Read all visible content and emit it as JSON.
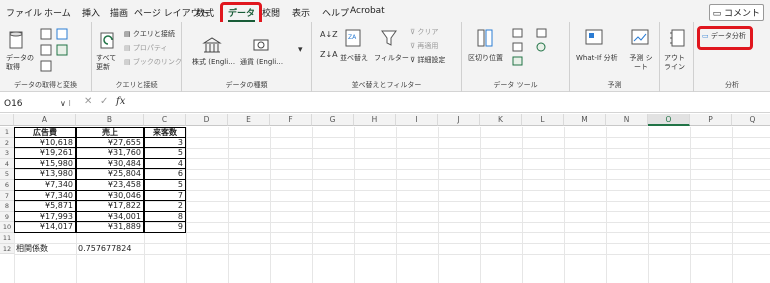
{
  "menu": {
    "tabs": [
      "ファイル",
      "ホーム",
      "挿入",
      "描画",
      "ページ レイアウト",
      "数式",
      "データ",
      "校閲",
      "表示",
      "ヘルプ",
      "Acrobat"
    ],
    "active": "データ",
    "comment_label": "コメント"
  },
  "ribbon": {
    "get_data": {
      "label": "データの 取得",
      "title": "データの取得と変換"
    },
    "refresh": {
      "label": "すべて 更新",
      "query_conn": "クエリと接続",
      "properties": "プロパティ",
      "links": "ブックのリンク",
      "title": "クエリと接続"
    },
    "datatypes": {
      "stock": "株式 (Engli…",
      "currency": "通貨 (Engli…",
      "title": "データの種類"
    },
    "sort": {
      "sort_btn": "並べ替え",
      "filter": "フィルター",
      "clear": "クリア",
      "reapply": "再適用",
      "advanced": "詳細設定",
      "title": "並べ替えとフィルター"
    },
    "tools": {
      "split": "区切り位置",
      "title": "データ ツール"
    },
    "forecast": {
      "whatif": "What-If 分析",
      "sheet": "予測 シート",
      "title": "予測"
    },
    "outline": {
      "label": "アウト ライン"
    },
    "analysis": {
      "button": "データ分析",
      "title": "分析"
    }
  },
  "formula_bar": {
    "cell_ref": "O16",
    "fx": "fx",
    "value": ""
  },
  "columns": [
    "A",
    "B",
    "C",
    "D",
    "E",
    "F",
    "G",
    "H",
    "I",
    "J",
    "K",
    "L",
    "M",
    "N",
    "O",
    "P",
    "Q"
  ],
  "selected_column": "O",
  "headers": [
    "広告費",
    "売上",
    "来客数"
  ],
  "rows": [
    [
      "¥10,618",
      "¥27,655",
      "3"
    ],
    [
      "¥19,261",
      "¥31,760",
      "5"
    ],
    [
      "¥15,980",
      "¥30,484",
      "4"
    ],
    [
      "¥13,980",
      "¥25,804",
      "6"
    ],
    [
      "¥7,340",
      "¥23,458",
      "5"
    ],
    [
      "¥7,340",
      "¥30,046",
      "7"
    ],
    [
      "¥5,871",
      "¥17,822",
      "2"
    ],
    [
      "¥17,993",
      "¥34,001",
      "8"
    ],
    [
      "¥14,017",
      "¥31,889",
      "9"
    ]
  ],
  "correlation": {
    "label": "相関係数",
    "value": "0.757677824"
  },
  "row_numbers": [
    "1",
    "2",
    "3",
    "4",
    "5",
    "6",
    "7",
    "8",
    "9",
    "10",
    "11",
    "12"
  ]
}
